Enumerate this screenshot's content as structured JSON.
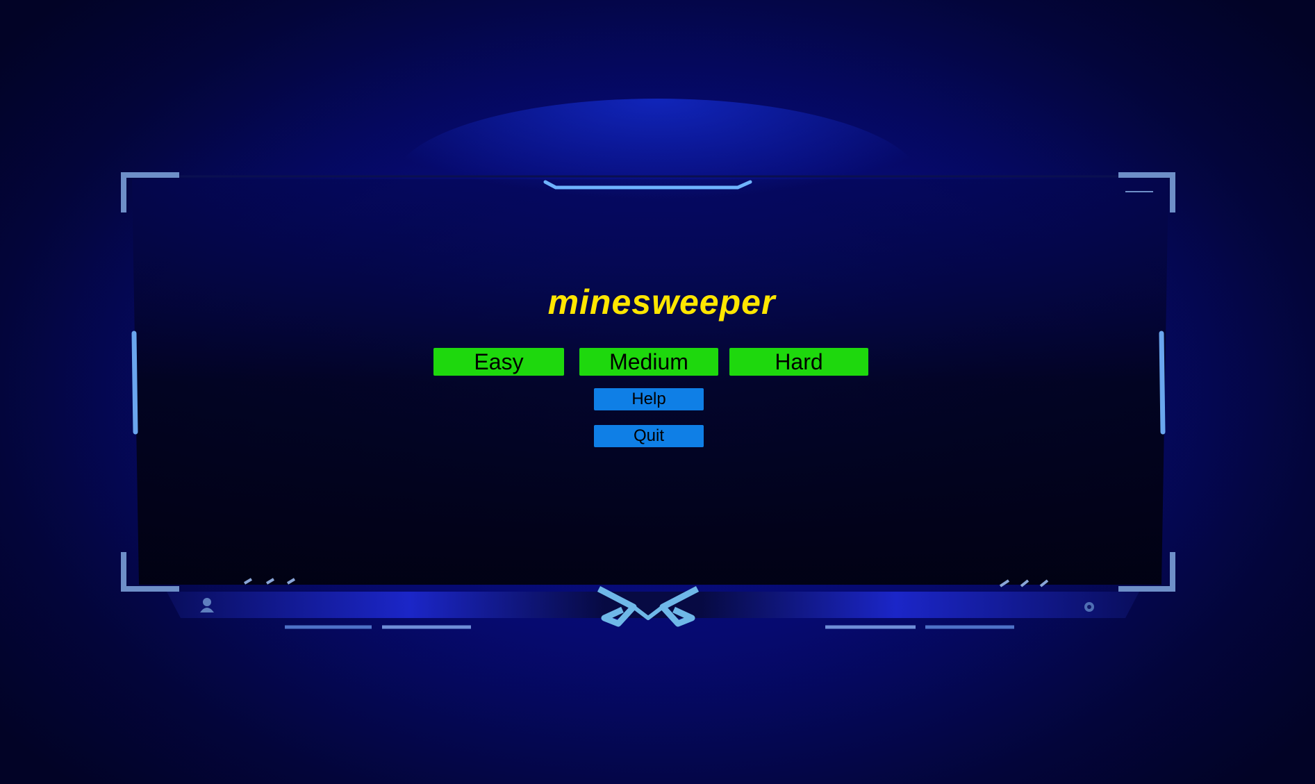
{
  "title": "minesweeper",
  "difficulty_buttons": {
    "easy_label": "Easy",
    "medium_label": "Medium",
    "hard_label": "Hard"
  },
  "menu_buttons": {
    "help_label": "Help",
    "quit_label": "Quit"
  },
  "colors": {
    "title": "#ffe600",
    "difficulty_button": "#1ed80d",
    "menu_button": "#0f7fe6",
    "background": "#060a70",
    "frame_accent": "#5aa8ff"
  },
  "icons": [
    "frame-emblem-icon",
    "user-icon",
    "settings-icon"
  ]
}
